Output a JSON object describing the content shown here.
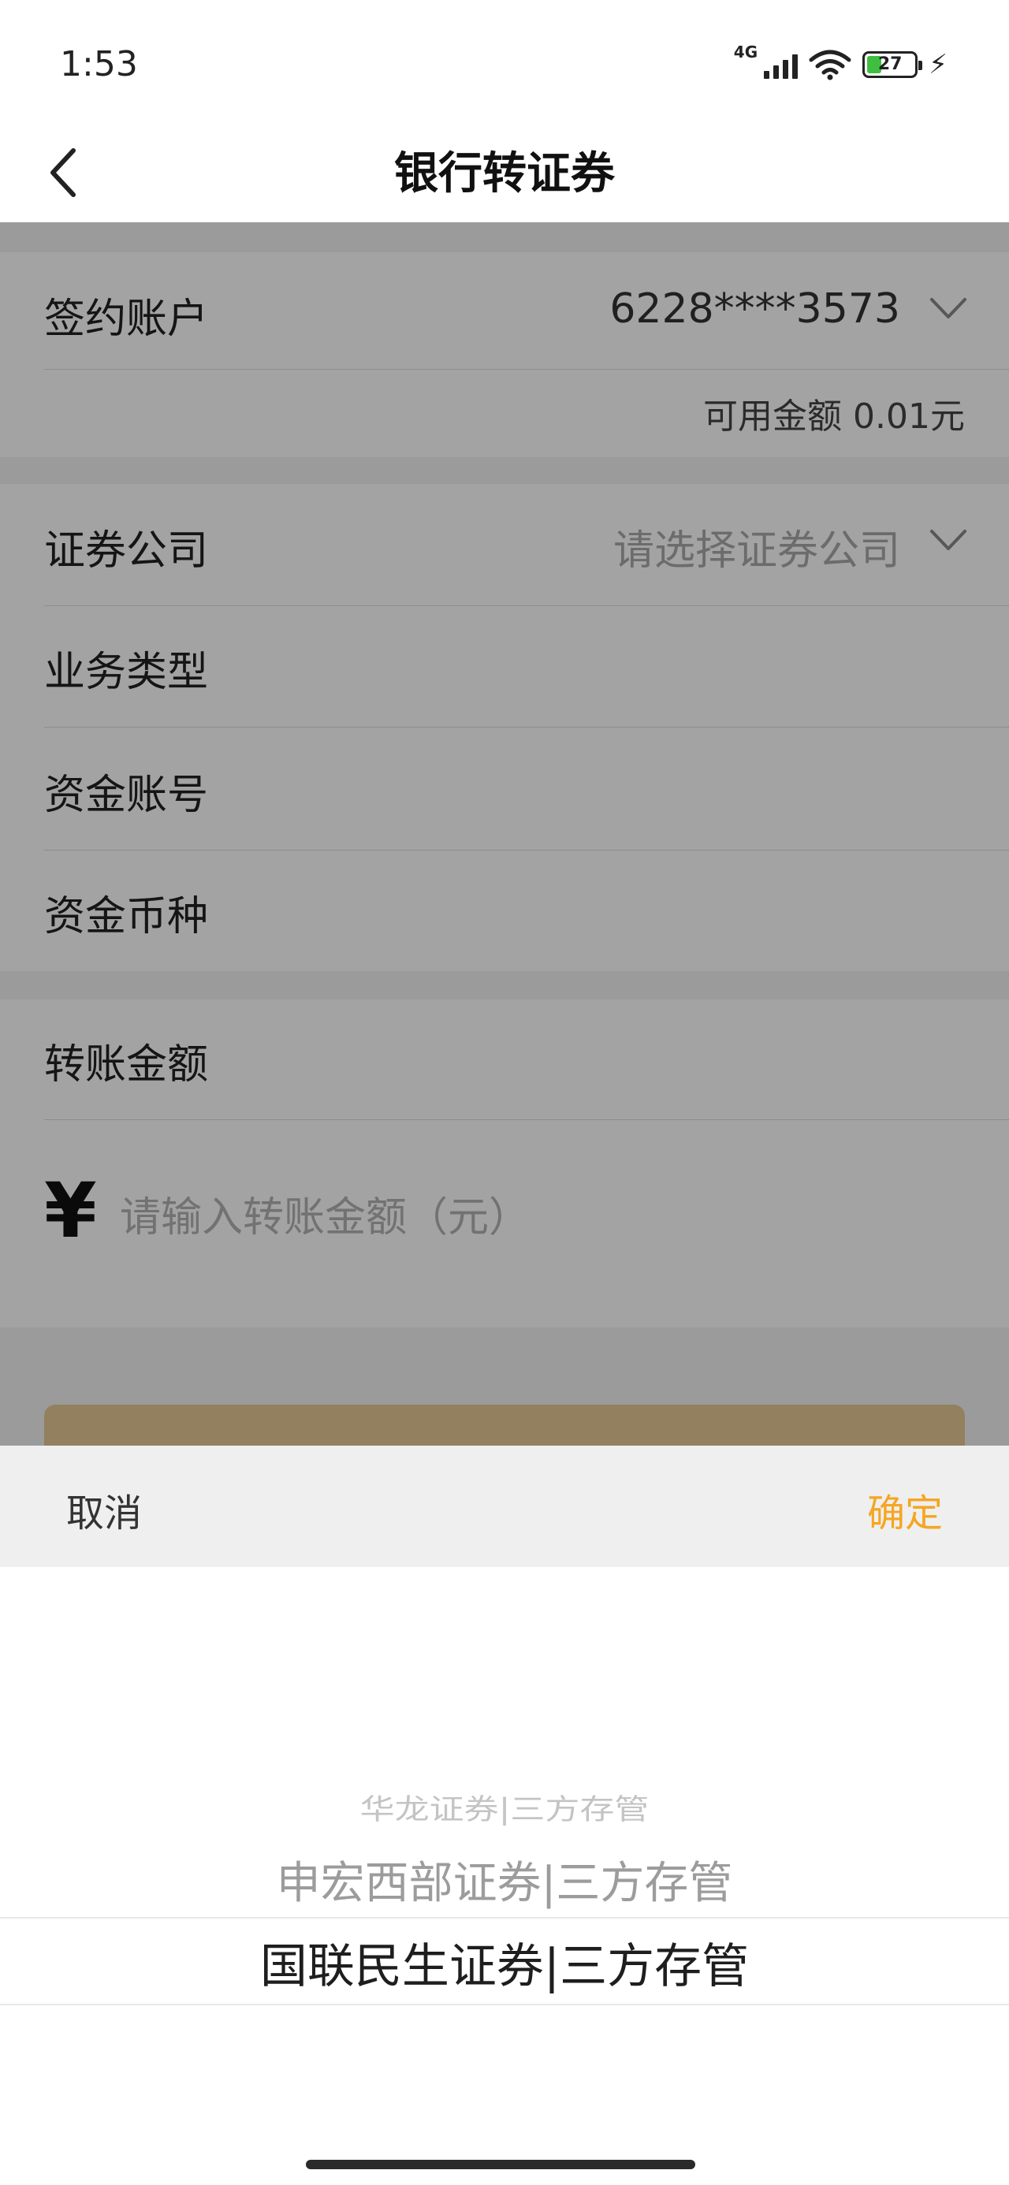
{
  "status_bar": {
    "time": "1:53",
    "network": "4G",
    "battery_level": "27",
    "icons": [
      "signal-icon",
      "wifi-icon",
      "battery-icon",
      "charging-icon"
    ]
  },
  "nav": {
    "title": "银行转证券",
    "back_icon": "chevron-left-icon"
  },
  "form": {
    "account": {
      "label": "签约账户",
      "value": "6228****3573"
    },
    "balance": "可用金额 0.01元",
    "broker": {
      "label": "证券公司",
      "placeholder": "请选择证券公司"
    },
    "business_type": {
      "label": "业务类型"
    },
    "fund_account": {
      "label": "资金账号"
    },
    "currency": {
      "label": "资金币种"
    },
    "amount": {
      "label": "转账金额",
      "symbol": "¥",
      "placeholder": "请输入转账金额（元）"
    }
  },
  "picker": {
    "cancel_label": "取消",
    "confirm_label": "确定",
    "options": [
      "华龙证券|三方存管",
      "申宏西部证券|三方存管",
      "国联民生证券|三方存管"
    ],
    "selected_index": 2
  },
  "colors": {
    "accent": "#f5a623",
    "submit_button": "#e6c995",
    "overlay": "rgba(0,0,0,0.36)"
  }
}
